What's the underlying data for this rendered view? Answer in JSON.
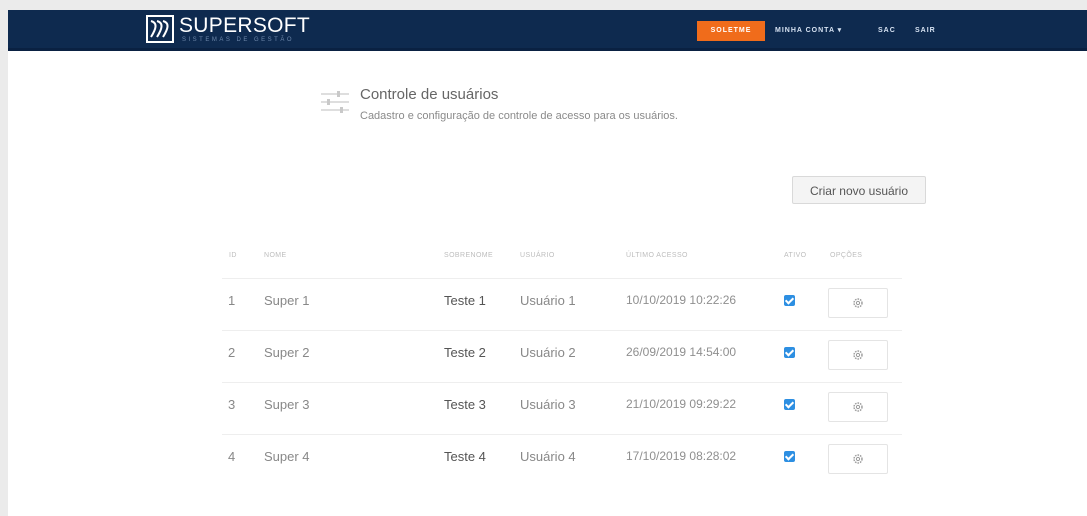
{
  "brand": {
    "name": "SUPERSOFT",
    "tagline": "SISTEMAS DE GESTÃO"
  },
  "nav": {
    "highlight": "SOLETME",
    "account": "MINHA CONTA ▾",
    "sac": "SAC",
    "exit": "SAIR"
  },
  "page": {
    "title": "Controle de usuários",
    "subtitle": "Cadastro e configuração de controle de acesso para os usuários."
  },
  "actions": {
    "create_user": "Criar novo usuário"
  },
  "table": {
    "headers": {
      "id": "ID",
      "name": "NOME",
      "surname": "SOBRENOME",
      "user": "USUÁRIO",
      "last_access": "ÚLTIMO ACESSO",
      "active": "ATIVO",
      "options": "OPÇÕES"
    },
    "rows": [
      {
        "id": "1",
        "name": "Super 1",
        "surname": "Teste 1",
        "user": "Usuário 1",
        "last_access": "10/10/2019 10:22:26",
        "active": true
      },
      {
        "id": "2",
        "name": "Super 2",
        "surname": "Teste 2",
        "user": "Usuário 2",
        "last_access": "26/09/2019 14:54:00",
        "active": true
      },
      {
        "id": "3",
        "name": "Super 3",
        "surname": "Teste 3",
        "user": "Usuário 3",
        "last_access": "21/10/2019 09:29:22",
        "active": true
      },
      {
        "id": "4",
        "name": "Super 4",
        "surname": "Teste 4",
        "user": "Usuário 4",
        "last_access": "17/10/2019 08:28:02",
        "active": true
      }
    ]
  },
  "colors": {
    "topbar": "#0e2a4f",
    "accent": "#f06c1b",
    "checkbox": "#2d8fe2"
  },
  "icons": {
    "logo": "supersoft-logo-icon",
    "page": "sliders-icon",
    "options": "gear-icon"
  }
}
